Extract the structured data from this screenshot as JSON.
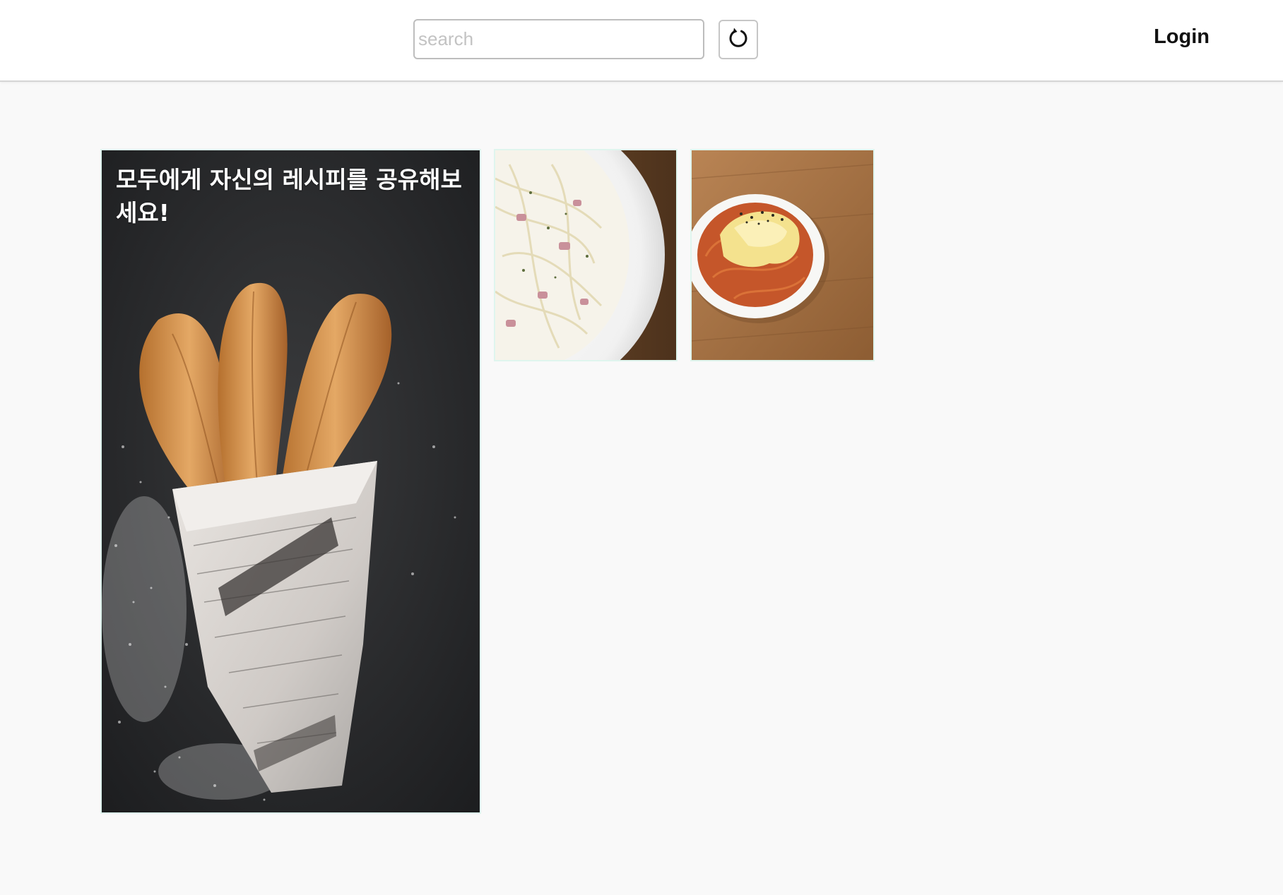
{
  "header": {
    "search": {
      "placeholder": "search",
      "value": ""
    },
    "refresh_icon": "refresh-icon",
    "login_label": "Login"
  },
  "gallery": {
    "featured": {
      "headline": "모두에게 자신의 레시피를 공유해보세요!",
      "image": "churros-in-newspaper"
    },
    "items": [
      {
        "image": "cream-pasta-plate"
      },
      {
        "image": "cheese-noodles-bowl"
      }
    ]
  },
  "colors": {
    "header_bg": "#ffffff",
    "page_bg": "#f9f9f9",
    "card_border": "#dff5ee",
    "text_dark": "#111111"
  }
}
